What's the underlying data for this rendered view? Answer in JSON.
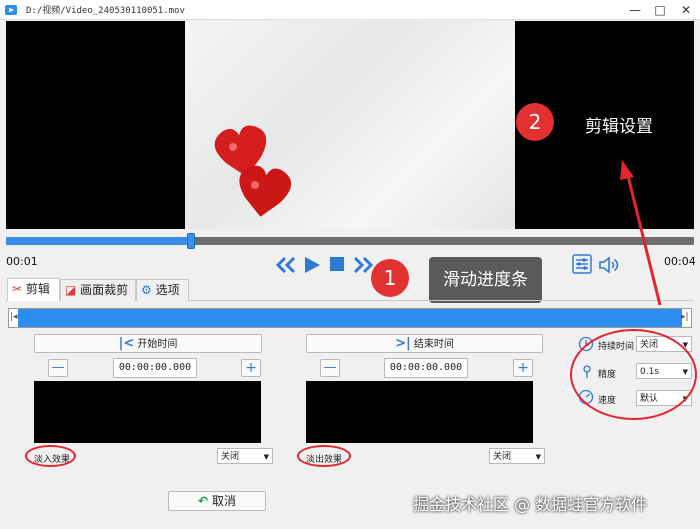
{
  "window": {
    "title": "D:/视频/Video_240530110051.mov",
    "minimize": "—",
    "maximize": "□",
    "close": "✕"
  },
  "player": {
    "current_time": "00:01",
    "total_time": "00:04",
    "progress": 0.27
  },
  "callouts": [
    {
      "number": "1",
      "label": "滑动进度条"
    },
    {
      "number": "2",
      "label": "剪辑设置"
    }
  ],
  "tabs": [
    {
      "label": "剪辑"
    },
    {
      "label": "画面裁剪"
    },
    {
      "label": "选项"
    }
  ],
  "clip": {
    "start": {
      "label": "开始时间",
      "time": "00:00:00.000",
      "minus": "—",
      "plus": "+"
    },
    "end": {
      "label": "结束时间",
      "time": "00:00:00.000",
      "minus": "—",
      "plus": "+"
    },
    "fade_in": {
      "label": "淡入效果",
      "value": "关闭"
    },
    "fade_out": {
      "label": "淡出效果",
      "value": "关闭"
    }
  },
  "settings": {
    "duration": {
      "label": "持续时间",
      "value": "关闭"
    },
    "precision": {
      "label": "精度",
      "value": "0.1s"
    },
    "speed": {
      "label": "速度",
      "value": "默认"
    }
  },
  "cancel_label": "取消",
  "watermark": "掘金技术社区 @ 数据蛙官方软件",
  "colors": {
    "accent": "#2e8ef0",
    "callout_red": "#e33131",
    "highlight_red": "#e2262f"
  }
}
